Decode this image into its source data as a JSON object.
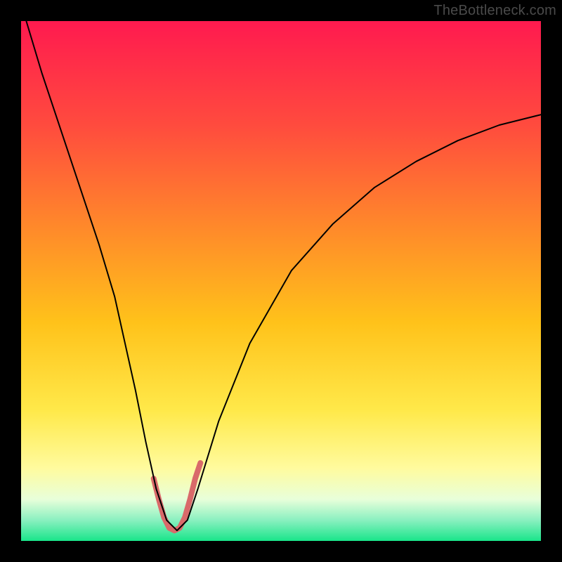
{
  "watermark": "TheBottleneck.com",
  "chart_data": {
    "type": "line",
    "title": "",
    "xlabel": "",
    "ylabel": "",
    "xlim": [
      0,
      100
    ],
    "ylim": [
      0,
      100
    ],
    "grid": false,
    "legend": false,
    "gradient_stops": [
      {
        "offset": 0,
        "color": "#ff1a4f"
      },
      {
        "offset": 0.2,
        "color": "#ff4b3e"
      },
      {
        "offset": 0.4,
        "color": "#ff8a2a"
      },
      {
        "offset": 0.58,
        "color": "#ffc21a"
      },
      {
        "offset": 0.75,
        "color": "#ffe94a"
      },
      {
        "offset": 0.86,
        "color": "#fffb9e"
      },
      {
        "offset": 0.92,
        "color": "#e8ffda"
      },
      {
        "offset": 0.96,
        "color": "#8af0c0"
      },
      {
        "offset": 1.0,
        "color": "#19e58a"
      }
    ],
    "series": [
      {
        "name": "bottleneck-curve",
        "stroke": "#000000",
        "stroke_width": 2,
        "x": [
          1,
          4,
          8,
          12,
          15,
          18,
          20,
          22,
          24,
          26,
          28,
          30,
          32,
          34,
          38,
          44,
          52,
          60,
          68,
          76,
          84,
          92,
          100
        ],
        "y": [
          100,
          90,
          78,
          66,
          57,
          47,
          38,
          29,
          19,
          10,
          4,
          2,
          4,
          10,
          23,
          38,
          52,
          61,
          68,
          73,
          77,
          80,
          82
        ]
      },
      {
        "name": "highlight-segment",
        "stroke": "#d96a6a",
        "stroke_width": 8,
        "x": [
          25.5,
          26.5,
          27.5,
          28.5,
          29.5,
          30.5,
          31.5,
          32.5,
          33.5,
          34.5
        ],
        "y": [
          12,
          8,
          4.5,
          2.5,
          2,
          2.5,
          4.5,
          8,
          12,
          15
        ]
      }
    ],
    "annotations": []
  }
}
